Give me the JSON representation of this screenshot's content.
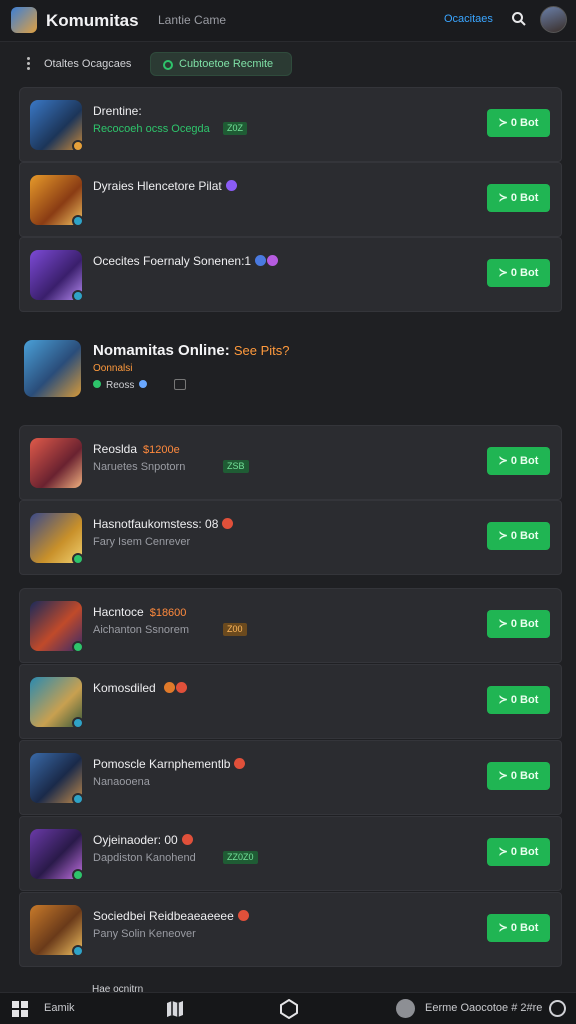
{
  "header": {
    "app_title": "Komumitas",
    "subtitle": "Lantie Came",
    "link": "Ocacitaes",
    "search_icon": "search-icon"
  },
  "filters": {
    "label": "Otaltes Ocagcaes",
    "chip": "Cubtoetoe Recmite"
  },
  "group1": [
    {
      "title": "Drentine:",
      "meta": "Recocoeh ocss Ocegda",
      "tag": "Z0Z",
      "button": "≻ 0 Bot"
    },
    {
      "title": "Dyraies Hlencetore Pilat",
      "meta": "",
      "tag": "",
      "button": "≻ 0 Bot"
    },
    {
      "title": "Ocecites Foernaly Sonenen:1",
      "meta": "",
      "tag": "",
      "button": "≻ 0 Bot"
    }
  ],
  "featured": {
    "title": "Nomamitas Online:",
    "accent": "See Pits?",
    "subtitle": "Oonnalsi",
    "row_label": "Reoss"
  },
  "group2": [
    {
      "title": "Reoslda",
      "price": "$1200e",
      "meta": "Naruetes Snpotorn",
      "tag": "ZSB",
      "button": "≻ 0 Bot"
    },
    {
      "title": "Hasnotfaukomstess: 08",
      "price": "",
      "meta": "Fary Isem Cenrever",
      "tag": "",
      "button": "≻ 0 Bot"
    }
  ],
  "group3": [
    {
      "title": "Hacntoce",
      "price": "$18600",
      "meta": "Aichanton Ssnorem",
      "tag": "Z00",
      "button": "≻ 0 Bot"
    },
    {
      "title": "Komosdiled",
      "price": "",
      "meta": "",
      "tag": "",
      "button": "≻ 0 Bot"
    },
    {
      "title": "Pomoscle Karnphementlb",
      "price": "",
      "meta": "Nanaooena",
      "tag": "",
      "button": "≻ 0 Bot"
    },
    {
      "title": "Oyjeinaoder: 00",
      "price": "",
      "meta": "Dapdiston Kanohend",
      "tag": "ZZ0Z0",
      "button": "≻ 0 Bot"
    },
    {
      "title": "Sociedbei Reidbeaeaeeee",
      "price": "",
      "meta": "Pany Solin Keneover",
      "tag": "",
      "button": "≻ 0 Bot"
    }
  ],
  "peek": "Hae ocnitrn",
  "bottom_bar": {
    "label": "Eamik",
    "status": "Eerme Oaocotoe # 2#re"
  }
}
